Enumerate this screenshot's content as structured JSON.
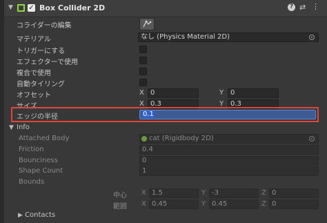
{
  "component": {
    "title": "Box Collider 2D",
    "enabled": true
  },
  "edit_collider": {
    "label": "コライダーの編集"
  },
  "material": {
    "label": "マテリアル",
    "value": "なし (Physics Material 2D)"
  },
  "is_trigger": {
    "label": "トリガーにする",
    "checked": false
  },
  "used_by_effector": {
    "label": "エフェクターで使用",
    "checked": false
  },
  "used_by_composite": {
    "label": "複合で使用",
    "checked": false
  },
  "auto_tiling": {
    "label": "自動タイリング",
    "checked": false
  },
  "offset": {
    "label": "オフセット",
    "x_label": "X",
    "x": "0",
    "y_label": "Y",
    "y": "0"
  },
  "size": {
    "label": "サイズ",
    "x_label": "X",
    "x": "0.3",
    "y_label": "Y",
    "y": "0.3"
  },
  "edge_radius": {
    "label": "エッジの半径",
    "value": "0.1"
  },
  "info": {
    "label": "Info",
    "attached_body_label": "Attached Body",
    "attached_body_value": "cat (Rigidbody 2D)",
    "friction_label": "Friction",
    "friction_value": "0.4",
    "bounciness_label": "Bounciness",
    "bounciness_value": "0",
    "shape_count_label": "Shape Count",
    "shape_count_value": "1",
    "bounds_label": "Bounds",
    "center_label": "中心",
    "center": {
      "x_label": "X",
      "x": "1.5",
      "y_label": "Y",
      "y": "-3",
      "z_label": "Z",
      "z": "0"
    },
    "extent_label": "範囲",
    "extent": {
      "x_label": "X",
      "x": "0.45",
      "y_label": "Y",
      "y": "0.45",
      "z_label": "Z",
      "z": "0"
    }
  },
  "contacts": {
    "label": "Contacts"
  },
  "colors": {
    "highlight": "#e0473a",
    "selection": "#2f61c8",
    "component_icon": "#8bdc3c"
  },
  "icons": [
    "foldout-arrow-icon",
    "collider-component-icon",
    "checkbox-checked-icon",
    "help-icon",
    "preset-icon",
    "more-menu-icon",
    "edit-collider-icon",
    "object-picker-icon",
    "rigidbody-icon"
  ]
}
